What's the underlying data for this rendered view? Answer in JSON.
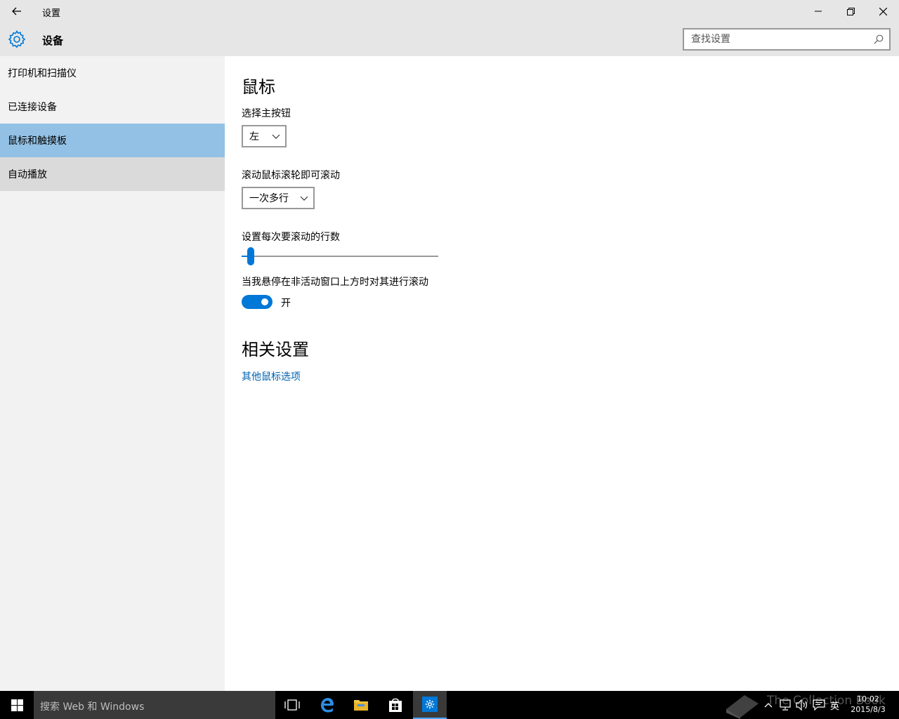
{
  "window": {
    "title": "设置",
    "section_title": "设备",
    "search_placeholder": "查找设置"
  },
  "sidebar": {
    "items": [
      {
        "label": "打印机和扫描仪"
      },
      {
        "label": "已连接设备"
      },
      {
        "label": "鼠标和触摸板"
      },
      {
        "label": "自动播放"
      }
    ]
  },
  "main": {
    "heading": "鼠标",
    "primary_button": {
      "label": "选择主按钮",
      "value": "左"
    },
    "wheel_scroll": {
      "label": "滚动鼠标滚轮即可滚动",
      "value": "一次多行"
    },
    "lines_to_scroll": {
      "label": "设置每次要滚动的行数",
      "value_fraction": 0.03
    },
    "inactive_scroll": {
      "label": "当我悬停在非活动窗口上方时对其进行滚动",
      "state": "开"
    },
    "related_heading": "相关设置",
    "related_link": "其他鼠标选项"
  },
  "taskbar": {
    "search_text": "搜索 Web 和 Windows",
    "ime": "英",
    "time": "10:02",
    "date": "2015/8/3",
    "watermark": "The Collection Book"
  },
  "colors": {
    "accent": "#0078d7",
    "selected_nav": "#93c1e5",
    "link": "#0063b1"
  }
}
